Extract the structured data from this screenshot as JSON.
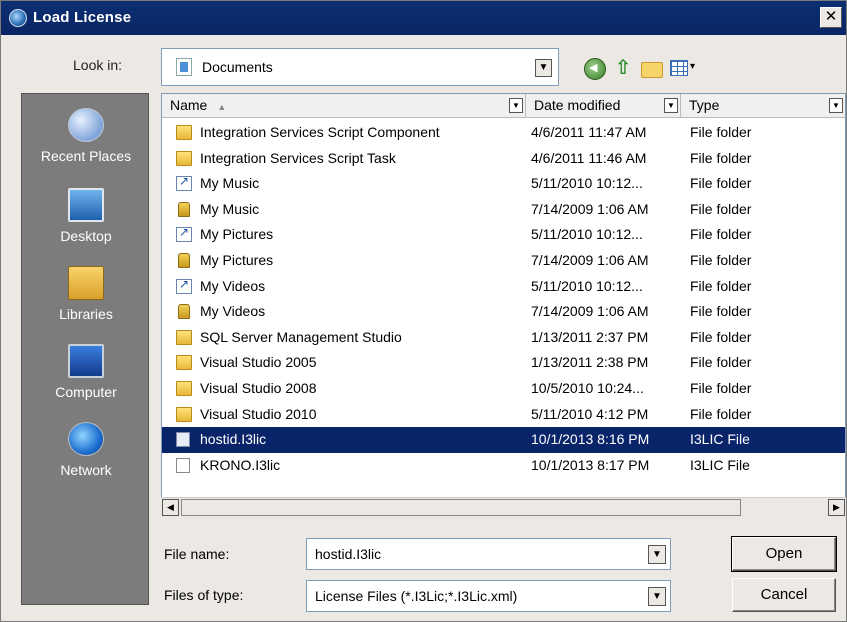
{
  "window": {
    "title": "Load License",
    "close_symbol": "✕"
  },
  "lookin": {
    "label": "Look in:",
    "value": "Documents"
  },
  "toolbar": {
    "up_symbol": "⇧"
  },
  "places": [
    {
      "label": "Recent Places",
      "icon": "recent-places-icon"
    },
    {
      "label": "Desktop",
      "icon": "desktop-icon"
    },
    {
      "label": "Libraries",
      "icon": "libraries-icon"
    },
    {
      "label": "Computer",
      "icon": "computer-icon"
    },
    {
      "label": "Network",
      "icon": "network-icon"
    }
  ],
  "columns": {
    "name": "Name",
    "date": "Date modified",
    "type": "Type"
  },
  "files": [
    {
      "name": "Integration Services Script Component",
      "date": "4/6/2011 11:47 AM",
      "type": "File folder",
      "icon": "folder"
    },
    {
      "name": "Integration Services Script Task",
      "date": "4/6/2011 11:46 AM",
      "type": "File folder",
      "icon": "folder"
    },
    {
      "name": "My Music",
      "date": "5/11/2010 10:12...",
      "type": "File folder",
      "icon": "shortcut"
    },
    {
      "name": "My Music",
      "date": "7/14/2009 1:06 AM",
      "type": "File folder",
      "icon": "locked"
    },
    {
      "name": "My Pictures",
      "date": "5/11/2010 10:12...",
      "type": "File folder",
      "icon": "shortcut"
    },
    {
      "name": "My Pictures",
      "date": "7/14/2009 1:06 AM",
      "type": "File folder",
      "icon": "locked"
    },
    {
      "name": "My Videos",
      "date": "5/11/2010 10:12...",
      "type": "File folder",
      "icon": "shortcut"
    },
    {
      "name": "My Videos",
      "date": "7/14/2009 1:06 AM",
      "type": "File folder",
      "icon": "locked"
    },
    {
      "name": "SQL Server Management Studio",
      "date": "1/13/2011 2:37 PM",
      "type": "File folder",
      "icon": "folder"
    },
    {
      "name": "Visual Studio 2005",
      "date": "1/13/2011 2:38 PM",
      "type": "File folder",
      "icon": "folder"
    },
    {
      "name": "Visual Studio 2008",
      "date": "10/5/2010 10:24...",
      "type": "File folder",
      "icon": "folder"
    },
    {
      "name": "Visual Studio 2010",
      "date": "5/11/2010 4:12 PM",
      "type": "File folder",
      "icon": "folder"
    },
    {
      "name": "hostid.I3lic",
      "date": "10/1/2013 8:16 PM",
      "type": "I3LIC File",
      "icon": "file",
      "selected": true
    },
    {
      "name": "KRONO.I3lic",
      "date": "10/1/2013 8:17 PM",
      "type": "I3LIC File",
      "icon": "file-white"
    }
  ],
  "filename": {
    "label": "File name:",
    "value": "hostid.I3lic"
  },
  "filetype": {
    "label": "Files of type:",
    "value": "License Files (*.I3Lic;*.I3Lic.xml)"
  },
  "buttons": {
    "open": "Open",
    "cancel": "Cancel"
  },
  "colors": {
    "titlebar": "#0c2f72",
    "selection": "#0a246a",
    "places_bg": "#7c7c7c"
  }
}
